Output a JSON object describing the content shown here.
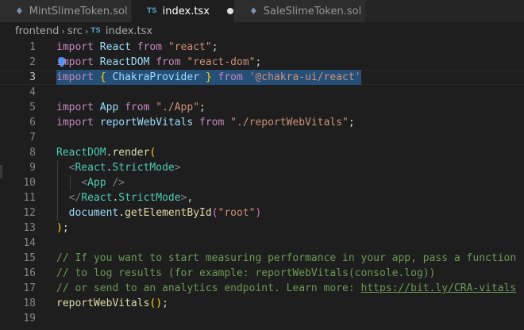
{
  "tabs": [
    {
      "icon": "♦",
      "label": "MintSlimeToken.sol",
      "active": false
    },
    {
      "icon": "TS",
      "label": "index.tsx",
      "active": true,
      "dirty": true
    },
    {
      "icon": "♦",
      "label": "SaleSlimeToken.sol",
      "active": false
    }
  ],
  "breadcrumb": {
    "items": [
      "frontend",
      "src"
    ],
    "file_icon": "TS",
    "file": "index.tsx",
    "separator": "›"
  },
  "editor": {
    "current_line": 3,
    "lines": [
      {
        "num": "1",
        "tokens": [
          [
            "k",
            "import"
          ],
          [
            "p",
            " "
          ],
          [
            "v",
            "React"
          ],
          [
            "p",
            " "
          ],
          [
            "k",
            "from"
          ],
          [
            "p",
            " "
          ],
          [
            "s",
            "\"react\""
          ],
          [
            "p",
            ";"
          ]
        ]
      },
      {
        "num": "2",
        "tokens": [
          [
            "k",
            "import"
          ],
          [
            "p",
            " "
          ],
          [
            "v",
            "ReactDOM"
          ],
          [
            "p",
            " "
          ],
          [
            "k",
            "from"
          ],
          [
            "p",
            " "
          ],
          [
            "s",
            "\"react-dom\""
          ],
          [
            "p",
            ";"
          ]
        ]
      },
      {
        "num": "3",
        "tokens": [
          [
            "k",
            "import"
          ],
          [
            "p",
            " "
          ],
          [
            "y",
            "{"
          ],
          [
            "p",
            " "
          ],
          [
            "v",
            "ChakraProvider"
          ],
          [
            "p",
            " "
          ],
          [
            "y",
            "}"
          ],
          [
            "p",
            " "
          ],
          [
            "k",
            "from"
          ],
          [
            "p",
            " "
          ],
          [
            "s",
            "'@chakra-ui/react'"
          ]
        ],
        "selected": true
      },
      {
        "num": "4",
        "tokens": []
      },
      {
        "num": "5",
        "tokens": [
          [
            "k",
            "import"
          ],
          [
            "p",
            " "
          ],
          [
            "v",
            "App"
          ],
          [
            "p",
            " "
          ],
          [
            "k",
            "from"
          ],
          [
            "p",
            " "
          ],
          [
            "s",
            "\"./App\""
          ],
          [
            "p",
            ";"
          ]
        ]
      },
      {
        "num": "6",
        "tokens": [
          [
            "k",
            "import"
          ],
          [
            "p",
            " "
          ],
          [
            "v",
            "reportWebVitals"
          ],
          [
            "p",
            " "
          ],
          [
            "k",
            "from"
          ],
          [
            "p",
            " "
          ],
          [
            "s",
            "\"./reportWebVitals\""
          ],
          [
            "p",
            ";"
          ]
        ]
      },
      {
        "num": "7",
        "tokens": []
      },
      {
        "num": "8",
        "tokens": [
          [
            "t",
            "ReactDOM"
          ],
          [
            "p",
            "."
          ],
          [
            "f",
            "render"
          ],
          [
            "y",
            "("
          ]
        ]
      },
      {
        "num": "9",
        "tokens": [
          [
            "p",
            "  "
          ],
          [
            "g",
            "<"
          ],
          [
            "t",
            "React"
          ],
          [
            "p",
            "."
          ],
          [
            "t",
            "StrictMode"
          ],
          [
            "g",
            ">"
          ]
        ]
      },
      {
        "num": "10",
        "tokens": [
          [
            "p",
            "    "
          ],
          [
            "g",
            "<"
          ],
          [
            "t",
            "App"
          ],
          [
            "p",
            " "
          ],
          [
            "g",
            "/>"
          ]
        ]
      },
      {
        "num": "11",
        "tokens": [
          [
            "p",
            "  "
          ],
          [
            "g",
            "</"
          ],
          [
            "t",
            "React"
          ],
          [
            "p",
            "."
          ],
          [
            "t",
            "StrictMode"
          ],
          [
            "g",
            ">"
          ],
          [
            "p",
            ","
          ]
        ]
      },
      {
        "num": "12",
        "tokens": [
          [
            "p",
            "  "
          ],
          [
            "v",
            "document"
          ],
          [
            "p",
            "."
          ],
          [
            "f",
            "getElementById"
          ],
          [
            "m",
            "("
          ],
          [
            "s",
            "\"root\""
          ],
          [
            "m",
            ")"
          ]
        ]
      },
      {
        "num": "13",
        "tokens": [
          [
            "y",
            ")"
          ],
          [
            "p",
            ";"
          ]
        ]
      },
      {
        "num": "14",
        "tokens": []
      },
      {
        "num": "15",
        "tokens": [
          [
            "c",
            "// If you want to start measuring performance in your app, pass a function"
          ]
        ]
      },
      {
        "num": "16",
        "tokens": [
          [
            "c",
            "// to log results (for example: reportWebVitals(console.log))"
          ]
        ]
      },
      {
        "num": "17",
        "tokens": [
          [
            "c",
            "// or send to an analytics endpoint. Learn more: "
          ],
          [
            "u",
            "https://bit.ly/CRA-vitals"
          ]
        ]
      },
      {
        "num": "18",
        "tokens": [
          [
            "f",
            "reportWebVitals"
          ],
          [
            "y",
            "("
          ],
          [
            "y",
            ")"
          ],
          [
            "p",
            ";"
          ]
        ]
      },
      {
        "num": "19",
        "tokens": []
      }
    ]
  }
}
